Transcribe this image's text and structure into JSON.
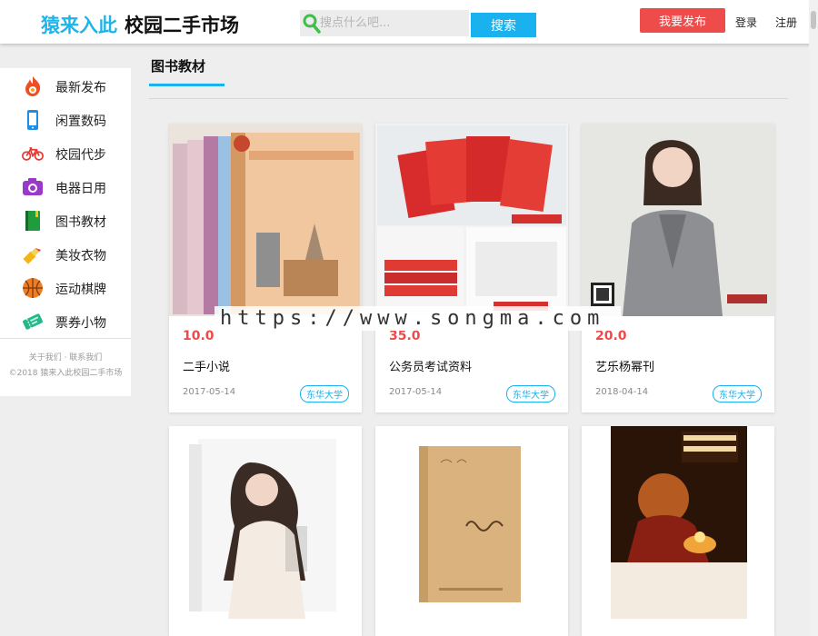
{
  "header": {
    "brand": "猿来入此",
    "site_name": "校园二手市场",
    "search_placeholder": "搜点什么吧...",
    "search_button": "搜索",
    "publish_button": "我要发布",
    "login": "登录",
    "register": "注册"
  },
  "sidebar": {
    "items": [
      {
        "label": "最新发布",
        "icon": "fire-icon",
        "color": "#f04d22"
      },
      {
        "label": "闲置数码",
        "icon": "phone-icon",
        "color": "#1c8fe3"
      },
      {
        "label": "校园代步",
        "icon": "bicycle-icon",
        "color": "#e53935"
      },
      {
        "label": "电器日用",
        "icon": "camera-icon",
        "color": "#9b37c9"
      },
      {
        "label": "图书教材",
        "icon": "book-icon",
        "color": "#1f9d3c"
      },
      {
        "label": "美妆衣物",
        "icon": "lipstick-icon",
        "color": "#f2b515"
      },
      {
        "label": "运动棋牌",
        "icon": "basketball-icon",
        "color": "#ef7d23"
      },
      {
        "label": "票券小物",
        "icon": "ticket-icon",
        "color": "#25b88a"
      }
    ],
    "footer_links": "关于我们 · 联系我们",
    "copyright": "©2018 猿来入此校园二手市场"
  },
  "main": {
    "section_title": "图书教材",
    "cards": [
      {
        "price": "10.0",
        "name": "二手小说",
        "date": "2017-05-14",
        "school": "东华大学",
        "image": "novel-books"
      },
      {
        "price": "35.0",
        "name": "公务员考试资料",
        "date": "2017-05-14",
        "school": "东华大学",
        "image": "exam-books"
      },
      {
        "price": "20.0",
        "name": "艺乐杨幂刊",
        "date": "2018-04-14",
        "school": "东华大学",
        "image": "magazine"
      },
      {
        "price": "",
        "name": "",
        "date": "",
        "school": "",
        "image": "book-woman-cover"
      },
      {
        "price": "",
        "name": "",
        "date": "",
        "school": "",
        "image": "book-women-ji"
      },
      {
        "price": "",
        "name": "",
        "date": "",
        "school": "",
        "image": "book-best-arrangement"
      }
    ]
  },
  "watermark": "https://www.songma.com",
  "colors": {
    "accent": "#19b2ee",
    "publish": "#ee4b4b",
    "price": "#ef4a4a"
  }
}
